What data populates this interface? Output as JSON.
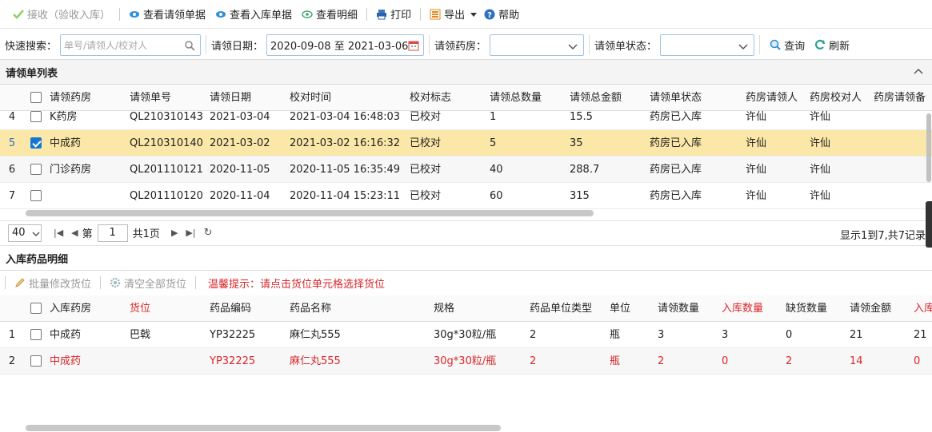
{
  "toolbar": {
    "receive_label": "接收（验收入库）",
    "view_request_label": "查看请领单据",
    "view_stockin_label": "查看入库单据",
    "view_detail_label": "查看明细",
    "print_label": "打印",
    "export_label": "导出",
    "help_label": "帮助"
  },
  "search": {
    "quick_label": "快速搜索：",
    "quick_placeholder": "单号/请领人/校对人",
    "date_label": "请领日期：",
    "date_value": "2020-09-08 至 2021-03-06",
    "pharmacy_label": "请领药房：",
    "pharmacy_value": "",
    "status_label": "请领单状态：",
    "status_value": "",
    "query_label": "查询",
    "refresh_label": "刷新"
  },
  "request_panel": {
    "title": "请领单列表",
    "columns": [
      "请领药房",
      "请领单号",
      "请领日期",
      "校对时间",
      "校对标志",
      "请领总数量",
      "请领总金额",
      "请领单状态",
      "药房请领人",
      "药房校对人",
      "药房请领备注"
    ],
    "rows": [
      {
        "rn": "4",
        "pharmacy": "K药房",
        "no": "QL210310143",
        "date": "2021-03-04",
        "check_time": "2021-03-04 16:48:03",
        "flag": "已校对",
        "qty": "1",
        "amount": "15.5",
        "status": "药房已入库",
        "requester": "许仙",
        "checker": "许仙",
        "checked": false
      },
      {
        "rn": "5",
        "pharmacy": "中成药",
        "no": "QL210310140",
        "date": "2021-03-02",
        "check_time": "2021-03-02 16:16:32",
        "flag": "已校对",
        "qty": "5",
        "amount": "35",
        "status": "药房已入库",
        "requester": "许仙",
        "checker": "许仙",
        "checked": true
      },
      {
        "rn": "6",
        "pharmacy": "门诊药房",
        "no": "QL201110121",
        "date": "2020-11-05",
        "check_time": "2020-11-05 16:35:49",
        "flag": "已校对",
        "qty": "40",
        "amount": "288.7",
        "status": "药房已入库",
        "requester": "许仙",
        "checker": "许仙",
        "checked": false
      },
      {
        "rn": "7",
        "pharmacy": "",
        "no": "QL201110120",
        "date": "2020-11-04",
        "check_time": "2020-11-04 15:23:11",
        "flag": "已校对",
        "qty": "60",
        "amount": "315",
        "status": "药房已入库",
        "requester": "许仙",
        "checker": "许仙",
        "checked": false
      }
    ]
  },
  "pager": {
    "page_size": "40",
    "page_prefix": "第",
    "page_value": "1",
    "page_suffix": "共1页",
    "info": "显示1到7,共7记录"
  },
  "detail_panel": {
    "title": "入库药品明细",
    "batch_edit_label": "批量修改货位",
    "clear_all_label": "清空全部货位",
    "hint": "温馨提示：请点击货位单元格选择货位",
    "columns": [
      "入库药房",
      "货位",
      "药品编码",
      "药品名称",
      "规格",
      "药品单位类型",
      "单位",
      "请领数量",
      "入库数量",
      "缺货数量",
      "请领金额",
      "入库金额"
    ],
    "rows": [
      {
        "rn": "1",
        "pharmacy": "中成药",
        "location": "巴戟",
        "code": "YP32225",
        "name": "麻仁丸555",
        "spec": "30g*30粒/瓶",
        "unit_type": "2",
        "unit": "瓶",
        "req_qty": "3",
        "in_qty": "3",
        "short_qty": "0",
        "req_amount": "21",
        "in_amount": "21"
      },
      {
        "rn": "2",
        "pharmacy": "中成药",
        "location": "",
        "code": "YP32225",
        "name": "麻仁丸555",
        "spec": "30g*30粒/瓶",
        "unit_type": "2",
        "unit": "瓶",
        "req_qty": "2",
        "in_qty": "0",
        "short_qty": "2",
        "req_amount": "14",
        "in_amount": "0"
      }
    ]
  },
  "colors": {
    "accent": "#1677d2",
    "selected_row": "#fbe7a7",
    "warning_text": "#d9262a"
  }
}
